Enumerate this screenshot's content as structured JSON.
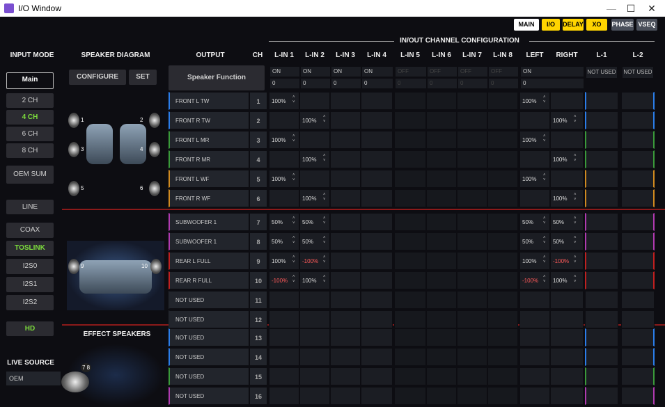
{
  "window": {
    "title": "I/O Window",
    "minimize": "—",
    "maximize": "☐",
    "close": "✕"
  },
  "tabs": [
    {
      "label": "MAIN",
      "bg": "#ffffff",
      "fg": "#000"
    },
    {
      "label": "I/O",
      "bg": "#ffd400",
      "fg": "#000"
    },
    {
      "label": "DELAY",
      "bg": "#ffd400",
      "fg": "#000"
    },
    {
      "label": "XO",
      "bg": "#ffd400",
      "fg": "#000"
    },
    {
      "label": "PHASE",
      "bg": "#4a4f5a",
      "fg": "#fff"
    },
    {
      "label": "VSEQ",
      "bg": "#4a4f5a",
      "fg": "#fff"
    }
  ],
  "headers": {
    "input_mode": "INPUT MODE",
    "speaker_diagram": "SPEAKER DIAGRAM",
    "output": "OUTPUT",
    "ch": "CH",
    "config": "IN/OUT CHANNEL CONFIGURATION",
    "effect": "EFFECT SPEAKERS",
    "live": "LIVE SOURCE"
  },
  "input_mode": {
    "main_label": "Main",
    "items": [
      {
        "label": "2 CH",
        "active": false
      },
      {
        "label": "4 CH",
        "active": true
      },
      {
        "label": "6 CH",
        "active": false
      },
      {
        "label": "8 CH",
        "active": false
      },
      {
        "label": "OEM SUM",
        "active": false
      }
    ],
    "line": "LINE",
    "digital": [
      {
        "label": "COAX",
        "active": false
      },
      {
        "label": "TOSLINK",
        "active": true
      },
      {
        "label": "I2S0",
        "active": false
      },
      {
        "label": "I2S1",
        "active": false
      },
      {
        "label": "I2S2",
        "active": false
      }
    ],
    "hd": "HD"
  },
  "live_source": {
    "value": "OEM"
  },
  "diagram": {
    "configure": "CONFIGURE",
    "set": "SET",
    "speakers_top": [
      "1",
      "2",
      "3",
      "4",
      "5",
      "6"
    ],
    "speakers_bottom": [
      "9",
      "10"
    ],
    "effect": "7 8"
  },
  "speaker_function": "Speaker Function",
  "columns": [
    "L-IN 1",
    "L-IN 2",
    "L-IN 3",
    "L-IN 4",
    "L-IN 5",
    "L-IN 6",
    "L-IN 7",
    "L-IN 8",
    "LEFT",
    "RIGHT",
    "L-1",
    "L-2"
  ],
  "column_state": [
    "ON",
    "ON",
    "ON",
    "ON",
    "OFF",
    "OFF",
    "OFF",
    "OFF",
    "ON",
    "",
    "NOT USED",
    "NOT USED"
  ],
  "column_value": [
    "0",
    "0",
    "0",
    "0",
    "0",
    "0",
    "0",
    "0",
    "0",
    "",
    "",
    ""
  ],
  "rows": [
    {
      "name": "FRONT L TW",
      "ch": "1",
      "vals": [
        "100%",
        "",
        "",
        "",
        "",
        "",
        "",
        "",
        "100%",
        ""
      ],
      "color": "#2b7de9"
    },
    {
      "name": "FRONT R TW",
      "ch": "2",
      "vals": [
        "",
        "100%",
        "",
        "",
        "",
        "",
        "",
        "",
        "",
        "100%"
      ],
      "color": "#2b7de9"
    },
    {
      "name": "FRONT L MR",
      "ch": "3",
      "vals": [
        "100%",
        "",
        "",
        "",
        "",
        "",
        "",
        "",
        "100%",
        ""
      ],
      "color": "#3a9a3a"
    },
    {
      "name": "FRONT R MR",
      "ch": "4",
      "vals": [
        "",
        "100%",
        "",
        "",
        "",
        "",
        "",
        "",
        "",
        "100%"
      ],
      "color": "#3a9a3a"
    },
    {
      "name": "FRONT L WF",
      "ch": "5",
      "vals": [
        "100%",
        "",
        "",
        "",
        "",
        "",
        "",
        "",
        "100%",
        ""
      ],
      "color": "#d08a20"
    },
    {
      "name": "FRONT R WF",
      "ch": "6",
      "vals": [
        "",
        "100%",
        "",
        "",
        "",
        "",
        "",
        "",
        "",
        "100%"
      ],
      "color": "#d08a20"
    },
    {
      "name": "SUBWOOFER 1",
      "ch": "7",
      "vals": [
        "50%",
        "50%",
        "",
        "",
        "",
        "",
        "",
        "",
        "50%",
        "50%"
      ],
      "color": "#b03ab0"
    },
    {
      "name": "SUBWOOFER 1",
      "ch": "8",
      "vals": [
        "50%",
        "50%",
        "",
        "",
        "",
        "",
        "",
        "",
        "50%",
        "50%"
      ],
      "color": "#b03ab0"
    },
    {
      "name": "REAR L FULL",
      "ch": "9",
      "vals": [
        "100%",
        "-100%",
        "",
        "",
        "",
        "",
        "",
        "",
        "100%",
        "-100%"
      ],
      "color": "#c02020"
    },
    {
      "name": "REAR R FULL",
      "ch": "10",
      "vals": [
        "-100%",
        "100%",
        "",
        "",
        "",
        "",
        "",
        "",
        "-100%",
        "100%"
      ],
      "color": "#c02020"
    },
    {
      "name": "NOT USED",
      "ch": "11",
      "vals": [
        "",
        "",
        "",
        "",
        "",
        "",
        "",
        "",
        "",
        ""
      ],
      "color": ""
    },
    {
      "name": "NOT USED",
      "ch": "12",
      "vals": [
        "",
        "",
        "",
        "",
        "",
        "",
        "",
        "",
        "",
        ""
      ],
      "color": ""
    },
    {
      "name": "NOT USED",
      "ch": "13",
      "vals": [
        "",
        "",
        "",
        "",
        "",
        "",
        "",
        "",
        "",
        ""
      ],
      "color": "#2b7de9"
    },
    {
      "name": "NOT USED",
      "ch": "14",
      "vals": [
        "",
        "",
        "",
        "",
        "",
        "",
        "",
        "",
        "",
        ""
      ],
      "color": "#2b7de9"
    },
    {
      "name": "NOT USED",
      "ch": "15",
      "vals": [
        "",
        "",
        "",
        "",
        "",
        "",
        "",
        "",
        "",
        ""
      ],
      "color": "#3a9a3a"
    },
    {
      "name": "NOT USED",
      "ch": "16",
      "vals": [
        "",
        "",
        "",
        "",
        "",
        "",
        "",
        "",
        "",
        ""
      ],
      "color": "#b03ab0"
    }
  ],
  "colors": {
    "active_text": "#7cdc3c",
    "negative": "#ff5a5a",
    "separator": "#8b1a1a"
  }
}
